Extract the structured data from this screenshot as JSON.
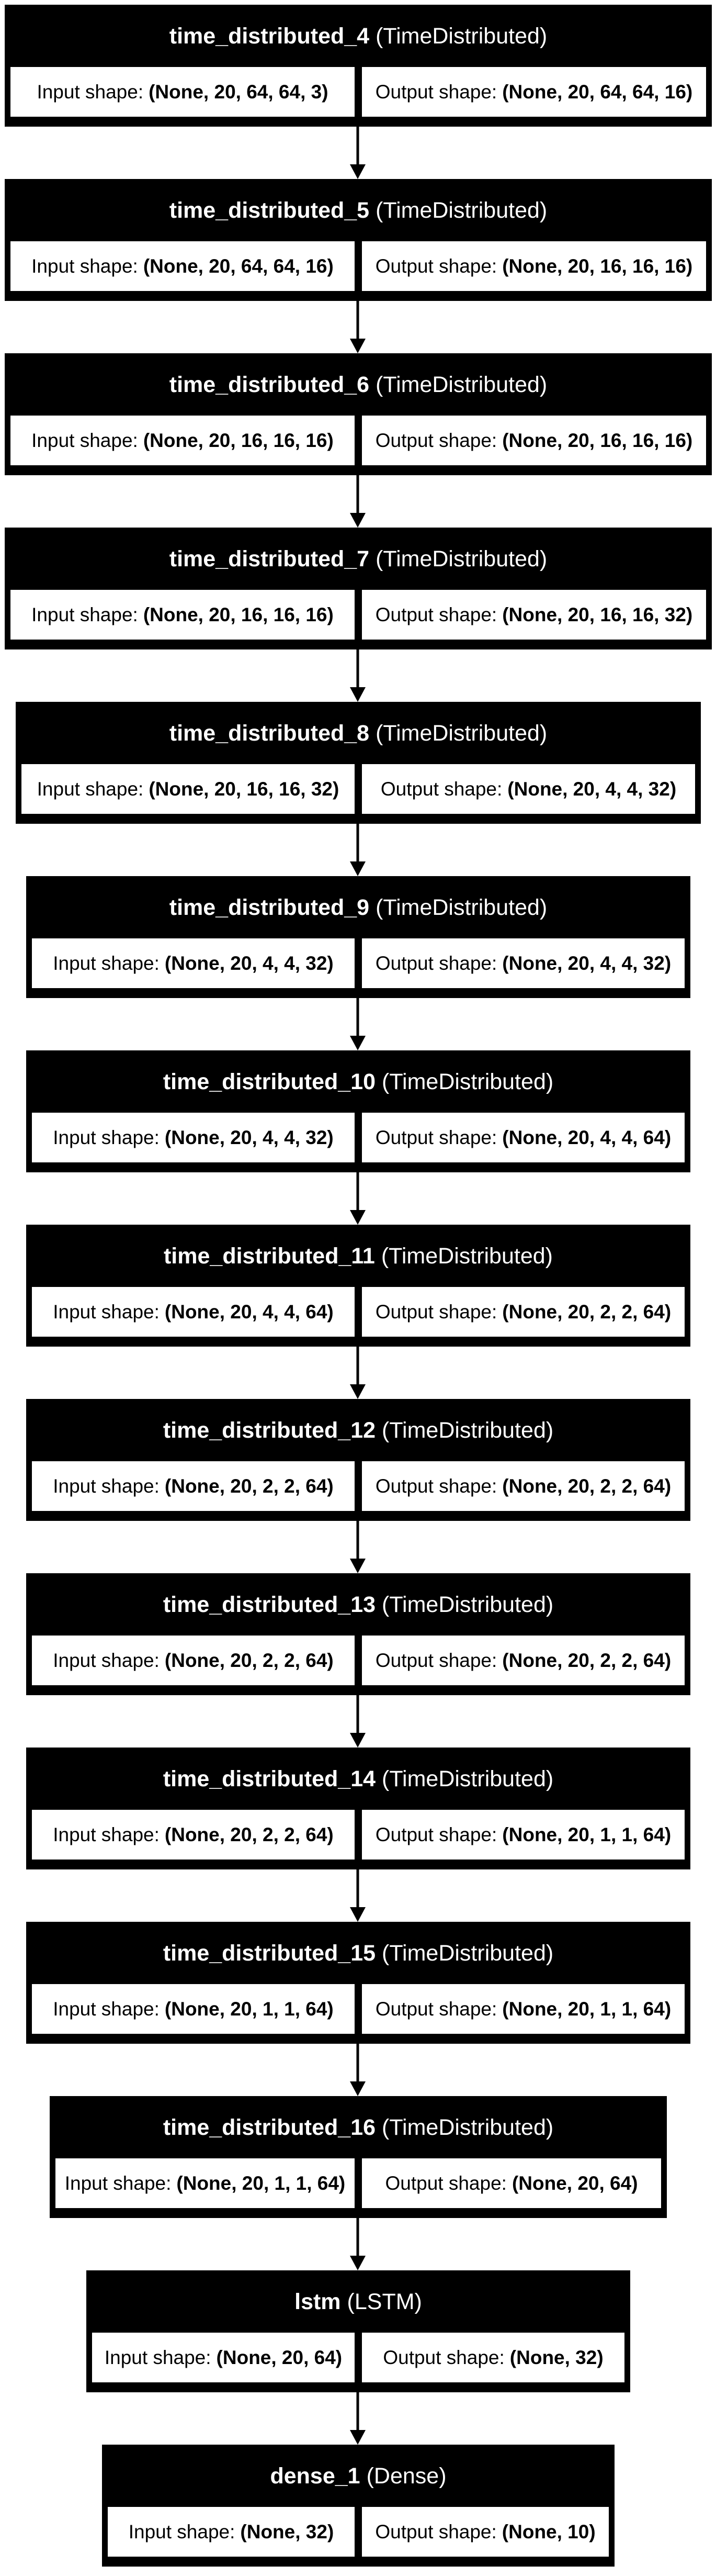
{
  "layers": [
    {
      "name": "time_distributed_4",
      "type": "(TimeDistributed)",
      "input_label": "Input shape:",
      "input": "(None, 20, 64, 64, 3)",
      "output_label": "Output shape:",
      "output": "(None, 20, 64, 64, 16)"
    },
    {
      "name": "time_distributed_5",
      "type": "(TimeDistributed)",
      "input_label": "Input shape:",
      "input": "(None, 20, 64, 64, 16)",
      "output_label": "Output shape:",
      "output": "(None, 20, 16, 16, 16)"
    },
    {
      "name": "time_distributed_6",
      "type": "(TimeDistributed)",
      "input_label": "Input shape:",
      "input": "(None, 20, 16, 16, 16)",
      "output_label": "Output shape:",
      "output": "(None, 20, 16, 16, 16)"
    },
    {
      "name": "time_distributed_7",
      "type": "(TimeDistributed)",
      "input_label": "Input shape:",
      "input": "(None, 20, 16, 16, 16)",
      "output_label": "Output shape:",
      "output": "(None, 20, 16, 16, 32)"
    },
    {
      "name": "time_distributed_8",
      "type": "(TimeDistributed)",
      "input_label": "Input shape:",
      "input": "(None, 20, 16, 16, 32)",
      "output_label": "Output shape:",
      "output": "(None, 20, 4, 4, 32)"
    },
    {
      "name": "time_distributed_9",
      "type": "(TimeDistributed)",
      "input_label": "Input shape:",
      "input": "(None, 20, 4, 4, 32)",
      "output_label": "Output shape:",
      "output": "(None, 20, 4, 4, 32)"
    },
    {
      "name": "time_distributed_10",
      "type": "(TimeDistributed)",
      "input_label": "Input shape:",
      "input": "(None, 20, 4, 4, 32)",
      "output_label": "Output shape:",
      "output": "(None, 20, 4, 4, 64)"
    },
    {
      "name": "time_distributed_11",
      "type": "(TimeDistributed)",
      "input_label": "Input shape:",
      "input": "(None, 20, 4, 4, 64)",
      "output_label": "Output shape:",
      "output": "(None, 20, 2, 2, 64)"
    },
    {
      "name": "time_distributed_12",
      "type": "(TimeDistributed)",
      "input_label": "Input shape:",
      "input": "(None, 20, 2, 2, 64)",
      "output_label": "Output shape:",
      "output": "(None, 20, 2, 2, 64)"
    },
    {
      "name": "time_distributed_13",
      "type": "(TimeDistributed)",
      "input_label": "Input shape:",
      "input": "(None, 20, 2, 2, 64)",
      "output_label": "Output shape:",
      "output": "(None, 20, 2, 2, 64)"
    },
    {
      "name": "time_distributed_14",
      "type": "(TimeDistributed)",
      "input_label": "Input shape:",
      "input": "(None, 20, 2, 2, 64)",
      "output_label": "Output shape:",
      "output": "(None, 20, 1, 1, 64)"
    },
    {
      "name": "time_distributed_15",
      "type": "(TimeDistributed)",
      "input_label": "Input shape:",
      "input": "(None, 20, 1, 1, 64)",
      "output_label": "Output shape:",
      "output": "(None, 20, 1, 1, 64)"
    },
    {
      "name": "time_distributed_16",
      "type": "(TimeDistributed)",
      "input_label": "Input shape:",
      "input": "(None, 20, 1, 1, 64)",
      "output_label": "Output shape:",
      "output": "(None, 20, 64)"
    },
    {
      "name": "lstm",
      "type": "(LSTM)",
      "input_label": "Input shape:",
      "input": "(None, 20, 64)",
      "output_label": "Output shape:",
      "output": "(None, 32)"
    },
    {
      "name": "dense_1",
      "type": "(Dense)",
      "input_label": "Input shape:",
      "input": "(None, 32)",
      "output_label": "Output shape:",
      "output": "(None, 10)"
    }
  ]
}
